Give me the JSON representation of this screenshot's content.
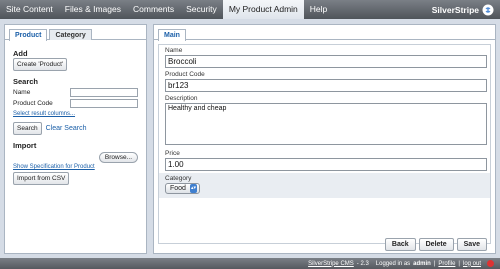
{
  "nav": {
    "items": [
      "Site Content",
      "Files & Images",
      "Comments",
      "Security",
      "My Product Admin",
      "Help"
    ],
    "active_index": 4,
    "brand": "SilverStripe"
  },
  "left": {
    "tabs": [
      "Product",
      "Category"
    ],
    "active_tab": 0,
    "add_title": "Add",
    "create_button": "Create 'Product'",
    "search_title": "Search",
    "name_label": "Name",
    "code_label": "Product Code",
    "name_value": "",
    "code_value": "",
    "select_columns_link": "Select result columns...",
    "search_button": "Search",
    "clear_search_link": "Clear Search",
    "import_title": "Import",
    "browse_button": "Browse...",
    "spec_link": "Show Specification for Product",
    "import_button": "Import from CSV"
  },
  "right": {
    "tab": "Main",
    "name_label": "Name",
    "name_value": "Broccoli",
    "code_label": "Product Code",
    "code_value": "br123",
    "desc_label": "Description",
    "desc_value": "Healthy and cheap",
    "price_label": "Price",
    "price_value": "1.00",
    "category_label": "Category",
    "category_value": "Food",
    "back_button": "Back",
    "delete_button": "Delete",
    "save_button": "Save"
  },
  "footer": {
    "cms_link": "SilverStripe CMS",
    "version": "- 2.3",
    "logged_in_prefix": "Logged in as",
    "user": "admin",
    "profile_link": "Profile",
    "logout_link": "log out"
  },
  "colors": {
    "link": "#1b5fa8",
    "topbar": "#4f545a",
    "panel_border": "#aab5c2"
  }
}
